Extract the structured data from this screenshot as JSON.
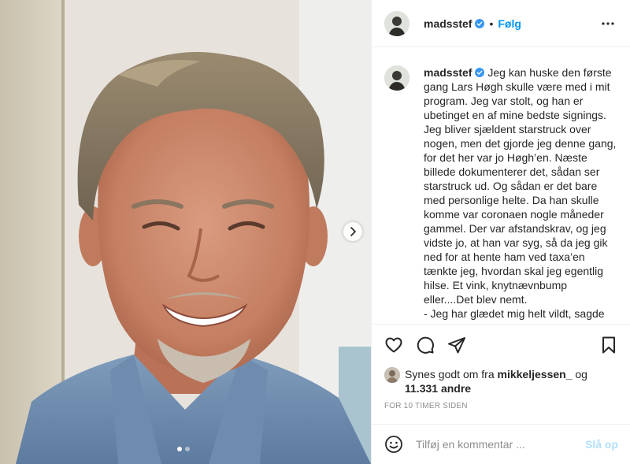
{
  "post": {
    "username": "madsstef",
    "verified": true,
    "separator": "•",
    "follow_label": "Følg",
    "more_icon": "more-horizontal-icon"
  },
  "media": {
    "carousel_next_icon": "chevron-right-icon",
    "carousel_count": 2,
    "carousel_active_index": 0
  },
  "caption": {
    "username": "madsstef",
    "text": "Jeg kan huske den første gang Lars Høgh skulle være med i mit program. Jeg var stolt, og han er ubetinget en af mine bedste signings. Jeg bliver sjældent starstruck over nogen, men det gjorde jeg denne gang, for det her var jo Høgh’en. Næste billede dokumenterer det, sådan ser starstruck ud. Og sådan er det bare med personlige helte. Da han skulle komme var coronaen nogle måneder gammel. Der var afstandskrav, og jeg vidste jo, at han var syg, så da jeg gik ned for at hente ham ved taxa’en tænkte jeg, hvordan skal jeg egentlig hilse. Et vink, knytnævnbump eller....Det blev nemt.\n- Jeg har glædet mig helt vildt, sagde han og trak forsigtigt ud"
  },
  "actions": {
    "like_icon": "heart-icon",
    "comment_icon": "comment-icon",
    "share_icon": "paper-plane-icon",
    "save_icon": "bookmark-icon"
  },
  "likes": {
    "prefix": "Synes godt om fra ",
    "liker": "mikkeljessen_",
    "connector": " og",
    "others": "11.331 andre"
  },
  "timestamp": "FOR 10 TIMER SIDEN",
  "comment": {
    "emoji_icon": "emoji-smile-icon",
    "placeholder": "Tilføj en kommentar ...",
    "post_label": "Slå op"
  },
  "colors": {
    "link_blue": "#0095f6",
    "verified_blue": "#3897f0",
    "post_disabled": "#b2dffc",
    "muted": "#8e8e8e",
    "border": "#efefef"
  }
}
